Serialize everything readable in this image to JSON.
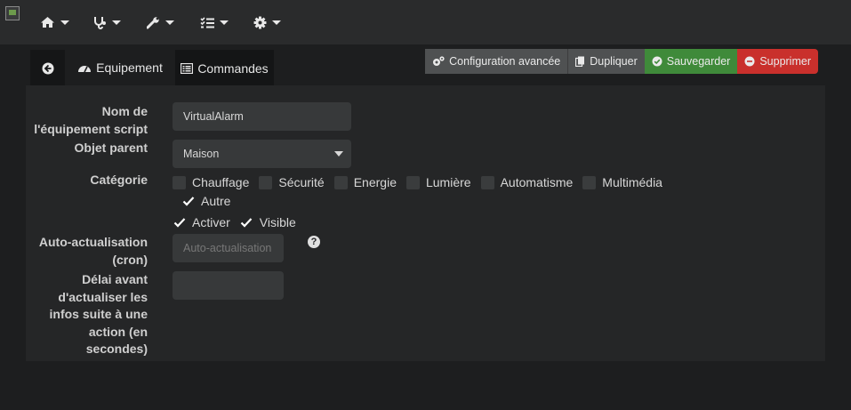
{
  "navbar": {
    "items": [
      {
        "icon": "home-icon"
      },
      {
        "icon": "stethoscope-icon"
      },
      {
        "icon": "wrench-icon"
      },
      {
        "icon": "tasks-icon"
      },
      {
        "icon": "gear-icon"
      }
    ]
  },
  "tabs": {
    "back_icon": "arrow-circle-left-icon",
    "equipement": "Equipement",
    "commandes": "Commandes"
  },
  "actions": {
    "config": "Configuration avancée",
    "dupliquer": "Dupliquer",
    "sauvegarder": "Sauvegarder",
    "supprimer": "Supprimer"
  },
  "form": {
    "name_label_1": "Nom de",
    "name_label_2": "l'équipement script",
    "name_value": "VirtualAlarm",
    "parent_label": "Objet parent",
    "parent_value": "Maison",
    "category_label": "Catégorie",
    "categories": [
      {
        "label": "Chauffage",
        "checked": false
      },
      {
        "label": "Sécurité",
        "checked": false
      },
      {
        "label": "Energie",
        "checked": false
      },
      {
        "label": "Lumière",
        "checked": false
      },
      {
        "label": "Automatisme",
        "checked": false
      },
      {
        "label": "Multimédia",
        "checked": false
      },
      {
        "label": "Autre",
        "checked": true
      }
    ],
    "activer": "Activer",
    "visible": "Visible",
    "cron_label_1": "Auto-actualisation",
    "cron_label_2": "(cron)",
    "cron_placeholder": "Auto-actualisation",
    "delay_label_1": "Délai avant",
    "delay_label_2": "d'actualiser les",
    "delay_label_3": "infos suite à une",
    "delay_label_4": "action (en",
    "delay_label_5": "secondes)",
    "delay_value": ""
  },
  "colors": {
    "accent": "#94c03e",
    "save": "#3f8a3a",
    "delete": "#c9302c"
  }
}
